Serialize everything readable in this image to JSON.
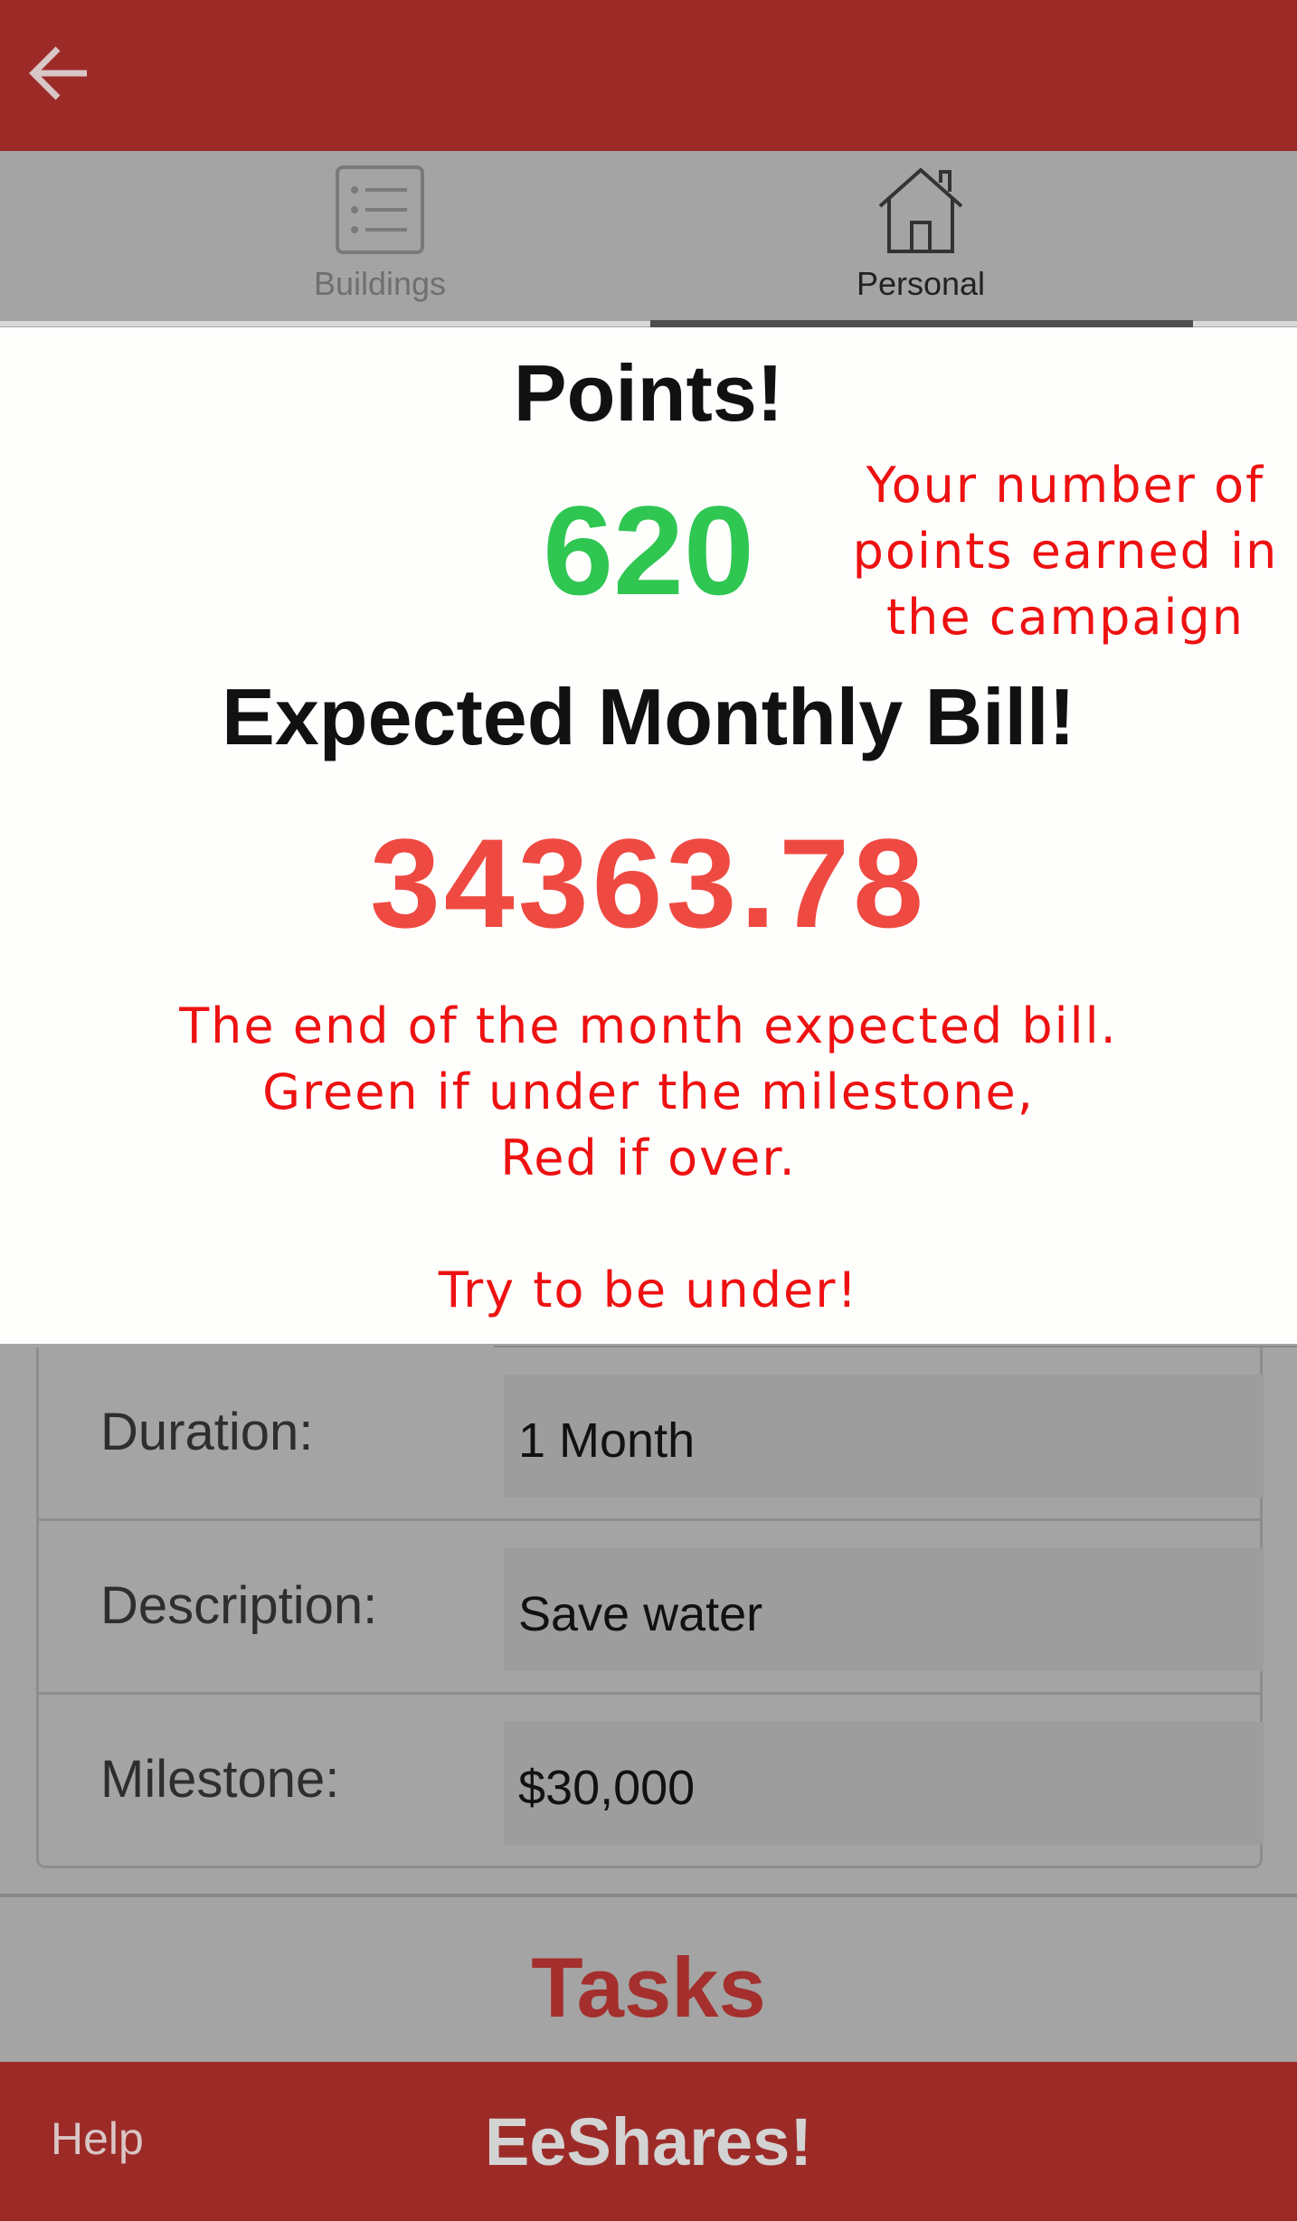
{
  "tabs": [
    {
      "label": "Buildings",
      "icon": "list-icon",
      "active": false
    },
    {
      "label": "Personal",
      "icon": "house-icon",
      "active": true
    }
  ],
  "overlay": {
    "points_title": "Points!",
    "points_value": "620",
    "points_note": "Your number of points earned in the campaign",
    "bill_title": "Expected Monthly Bill!",
    "bill_value": "34363.78",
    "bill_note_lines": [
      "The end of the month expected bill.",
      "Green if under the milestone,",
      "Red if over.",
      "",
      "Try to be under!"
    ]
  },
  "details": [
    {
      "label": "Duration:",
      "value": "1 Month"
    },
    {
      "label": "Description:",
      "value": "Save water"
    },
    {
      "label": "Milestone:",
      "value": "$30,000"
    }
  ],
  "tasks_label": "Tasks",
  "bottom": {
    "help_label": "Help",
    "brand": "EeShares!"
  },
  "colors": {
    "header": "#9c2b28",
    "points_green": "#2fc652",
    "bill_red": "#ee4a42",
    "note_red": "#ee1111"
  }
}
